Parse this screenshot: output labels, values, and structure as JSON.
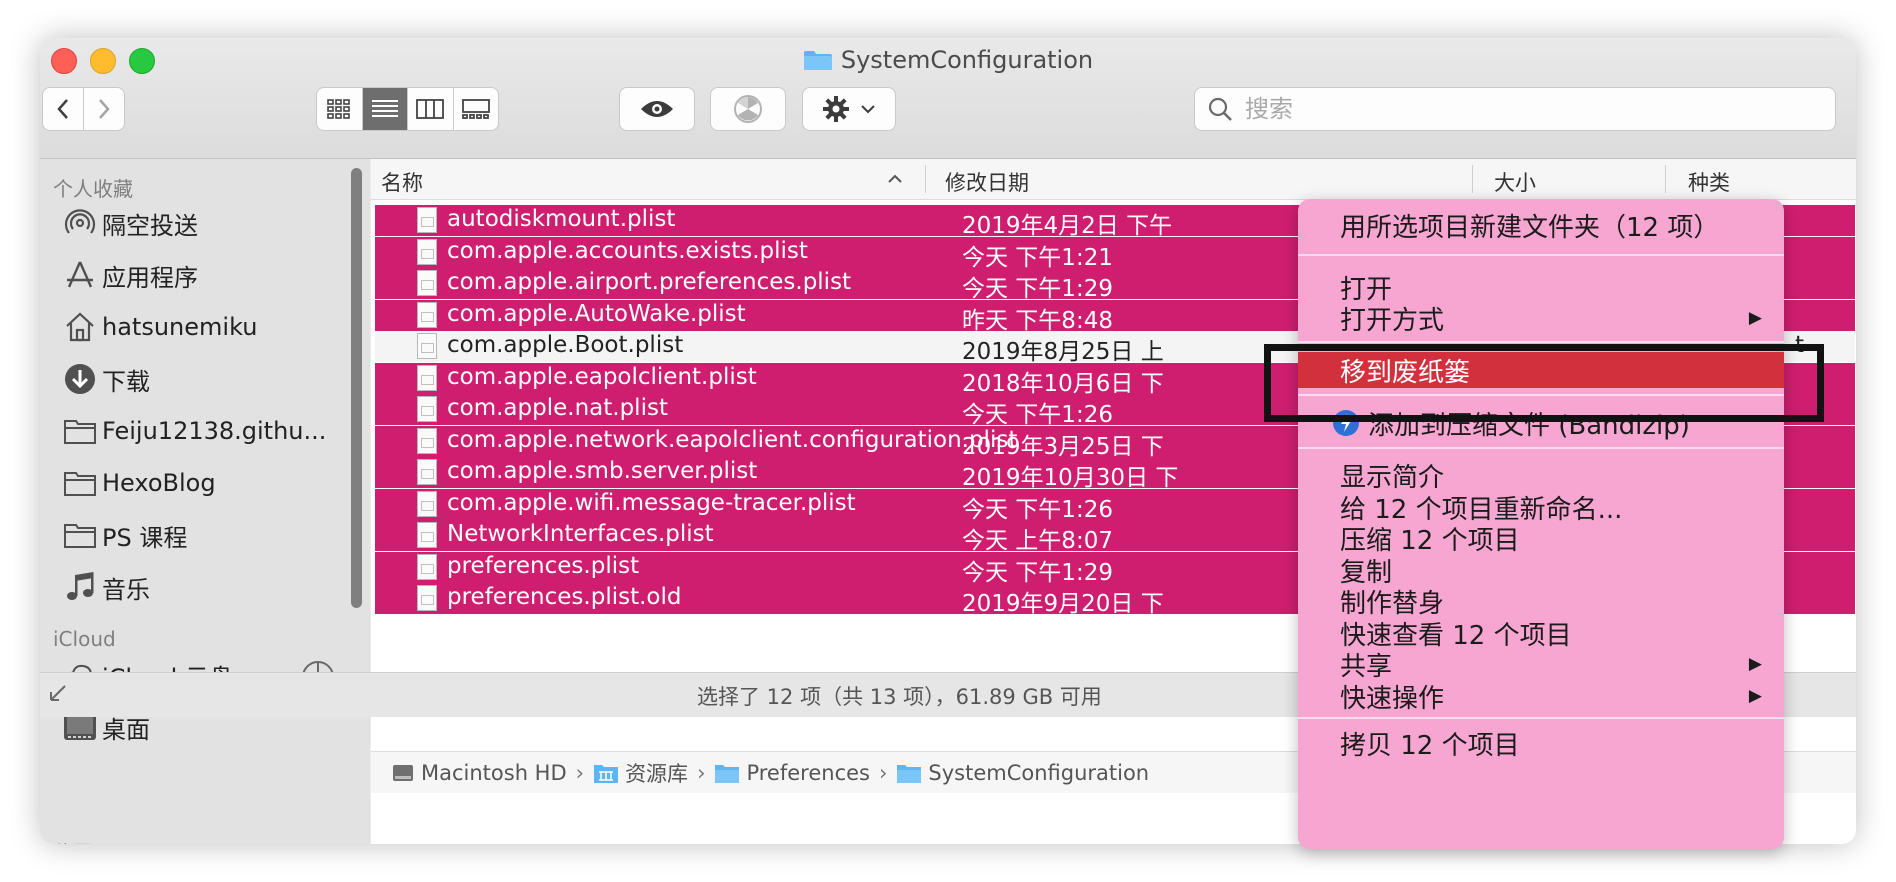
{
  "window": {
    "title": "SystemConfiguration"
  },
  "toolbar": {
    "back_label": "‹",
    "forward_label": "›",
    "search_placeholder": "搜索"
  },
  "sidebar": {
    "favorites_header": "个人收藏",
    "favorites": [
      {
        "label": "隔空投送",
        "icon": "airdrop-icon"
      },
      {
        "label": "应用程序",
        "icon": "applications-icon"
      },
      {
        "label": "hatsunemiku",
        "icon": "home-icon"
      },
      {
        "label": "下载",
        "icon": "downloads-icon"
      },
      {
        "label": "Feiju12138.githu...",
        "icon": "folder-icon"
      },
      {
        "label": "HexoBlog",
        "icon": "folder-icon"
      },
      {
        "label": "PS 课程",
        "icon": "folder-icon"
      },
      {
        "label": "音乐",
        "icon": "music-icon"
      }
    ],
    "icloud_header": "iCloud",
    "icloud": [
      {
        "label": "iCloud 云盘",
        "icon": "cloud-icon"
      },
      {
        "label": "桌面",
        "icon": "desktop-icon"
      }
    ],
    "locations_header": "位置"
  },
  "columns": {
    "name": "名称",
    "date": "修改日期",
    "size": "大小",
    "kind": "种类"
  },
  "files": [
    {
      "name": "autodiskmount.plist",
      "date": "2019年4月2日 下午",
      "kind": "",
      "selected": true
    },
    {
      "name": "com.apple.accounts.exists.plist",
      "date": "今天 下午1:21",
      "kind": "",
      "selected": true
    },
    {
      "name": "com.apple.airport.preferences.plist",
      "date": "今天 下午1:29",
      "kind": "",
      "selected": true
    },
    {
      "name": "com.apple.AutoWake.plist",
      "date": "昨天 下午8:48",
      "kind": "",
      "selected": true
    },
    {
      "name": "com.apple.Boot.plist",
      "date": "2019年8月25日 上",
      "kind": "t",
      "selected": false
    },
    {
      "name": "com.apple.eapolclient.plist",
      "date": "2018年10月6日 下",
      "kind": "",
      "selected": true
    },
    {
      "name": "com.apple.nat.plist",
      "date": "今天 下午1:26",
      "kind": "",
      "selected": true
    },
    {
      "name": "com.apple.network.eapolclient.configuration.plist",
      "date": "2019年3月25日 下",
      "kind": "",
      "selected": true
    },
    {
      "name": "com.apple.smb.server.plist",
      "date": "2019年10月30日 下",
      "kind": "",
      "selected": true
    },
    {
      "name": "com.apple.wifi.message-tracer.plist",
      "date": "今天 下午1:26",
      "kind": "",
      "selected": true
    },
    {
      "name": "NetworkInterfaces.plist",
      "date": "今天 上午8:07",
      "kind": "",
      "selected": true
    },
    {
      "name": "preferences.plist",
      "date": "今天 下午1:29",
      "kind": "",
      "selected": true
    },
    {
      "name": "preferences.plist.old",
      "date": "2019年9月20日 下",
      "kind": "",
      "selected": true
    }
  ],
  "pathbar": [
    {
      "label": "Macintosh HD",
      "icon": "disk-icon"
    },
    {
      "label": "资源库",
      "icon": "library-folder-icon"
    },
    {
      "label": "Preferences",
      "icon": "folder-icon"
    },
    {
      "label": "SystemConfiguration",
      "icon": "folder-icon"
    }
  ],
  "status": {
    "text": "选择了 12 项（共 13 项），61.89 GB 可用"
  },
  "context_menu": {
    "items": [
      {
        "label": "用所选项目新建文件夹（12 项）"
      },
      {
        "label": "打开"
      },
      {
        "label": "打开方式",
        "submenu": "▶"
      },
      {
        "label": "移到废纸篓",
        "highlighted": true
      },
      {
        "label": "添加到压缩文件 (Bandizip)"
      },
      {
        "label": "显示简介"
      },
      {
        "label": "给 12 个项目重新命名..."
      },
      {
        "label": "压缩 12 个项目"
      },
      {
        "label": "复制"
      },
      {
        "label": "制作替身"
      },
      {
        "label": "快速查看 12 个项目"
      },
      {
        "label": "共享",
        "submenu": "▶"
      },
      {
        "label": "快速操作",
        "submenu": "▶"
      },
      {
        "label": "拷贝 12 个项目"
      }
    ]
  },
  "colors": {
    "selection": "#cf1e6f",
    "menu_bg": "#f6a6d1",
    "menu_highlight": "#d3303e",
    "annotation_box": "#121212"
  }
}
